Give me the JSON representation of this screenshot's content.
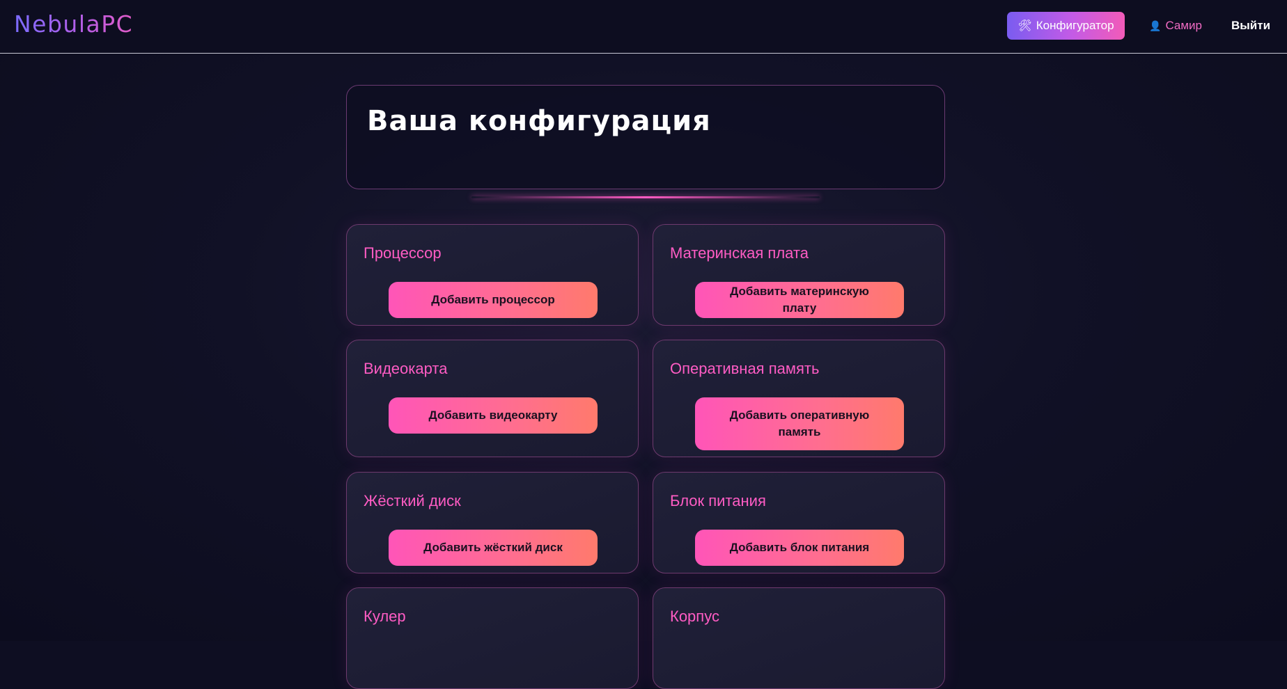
{
  "header": {
    "logo": "NebulaPC",
    "nav": {
      "configurator_label": "Конфигуратор",
      "configurator_icon": "tools-icon",
      "user_label": "Самир",
      "user_icon": "user-icon",
      "logout_label": "Выйти"
    }
  },
  "main": {
    "title": "Ваша конфигурация",
    "components": [
      {
        "name": "Процессор",
        "button": "Добавить процессор"
      },
      {
        "name": "Материнская плата",
        "button": "Добавить материнскую плату"
      },
      {
        "name": "Видеокарта",
        "button": "Добавить видеокарту"
      },
      {
        "name": "Оперативная память",
        "button": "Добавить оперативную память"
      },
      {
        "name": "Жёсткий диск",
        "button": "Добавить жёсткий диск"
      },
      {
        "name": "Блок питания",
        "button": "Добавить блок питания"
      },
      {
        "name": "Кулер",
        "button": ""
      },
      {
        "name": "Корпус",
        "button": ""
      }
    ]
  },
  "colors": {
    "background": "#0e0e22",
    "accent_pink": "#ff5cc4",
    "accent_purple": "#7b6cff",
    "button_gradient_end": "#ff7a6c"
  }
}
